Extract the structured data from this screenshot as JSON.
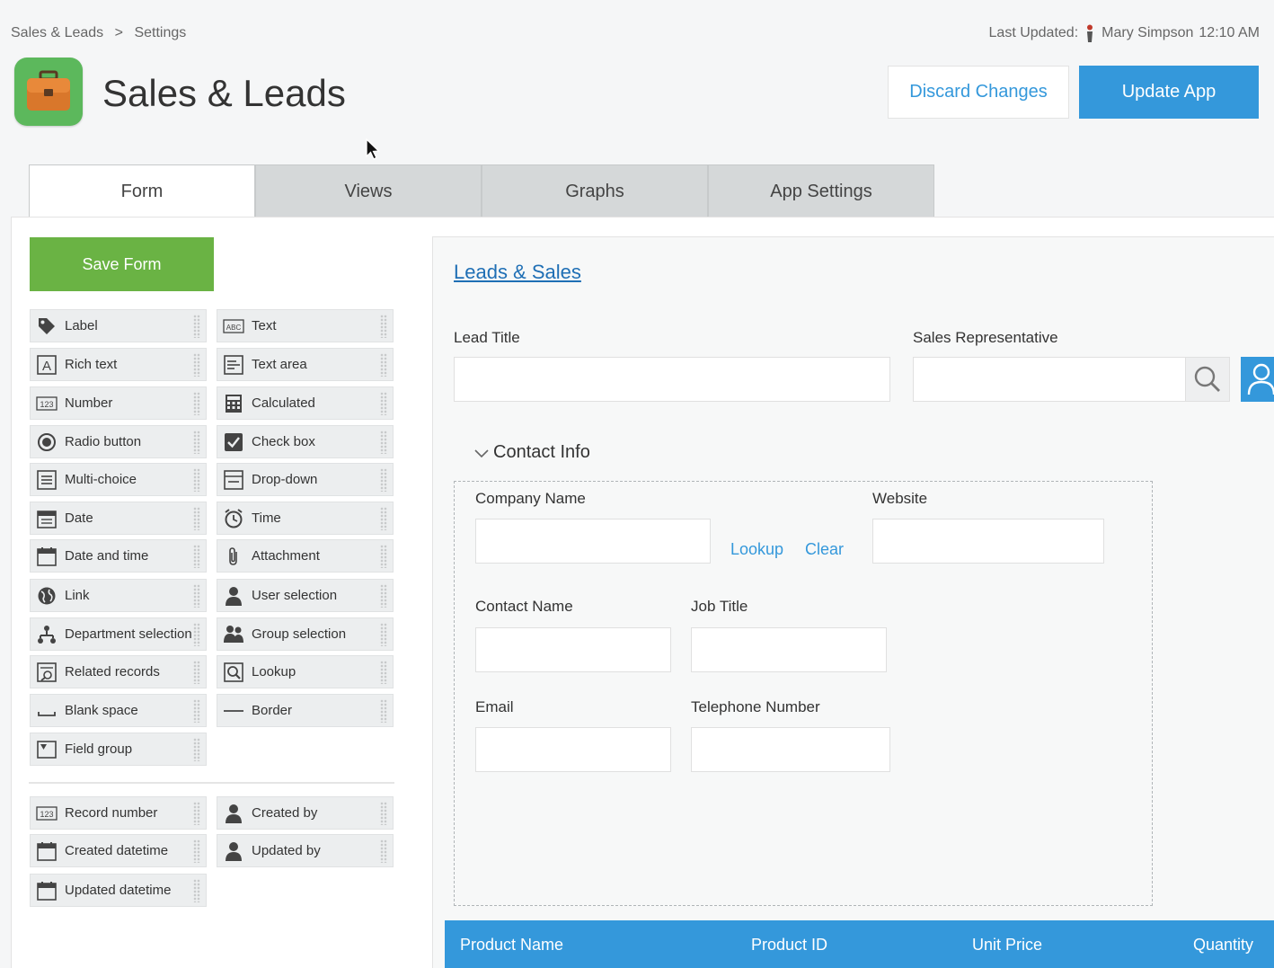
{
  "breadcrumb": {
    "root": "Sales & Leads",
    "separator": ">",
    "current": "Settings"
  },
  "last_updated": {
    "label": "Last Updated:",
    "user": "Mary Simpson",
    "time": "12:10 AM"
  },
  "app": {
    "title": "Sales & Leads",
    "icon": "briefcase-icon",
    "icon_bg": "#5cb85c"
  },
  "header_buttons": {
    "discard": "Discard Changes",
    "update": "Update App"
  },
  "tabs": [
    {
      "label": "Form"
    },
    {
      "label": "Views"
    },
    {
      "label": "Graphs"
    },
    {
      "label": "App Settings"
    }
  ],
  "palette": {
    "save_label": "Save Form",
    "items": [
      {
        "label": "Label",
        "icon": "tag-icon"
      },
      {
        "label": "Text",
        "icon": "text-field-icon"
      },
      {
        "label": "Rich text",
        "icon": "rich-text-icon"
      },
      {
        "label": "Text area",
        "icon": "text-area-icon"
      },
      {
        "label": "Number",
        "icon": "number-icon"
      },
      {
        "label": "Calculated",
        "icon": "calculator-icon"
      },
      {
        "label": "Radio button",
        "icon": "radio-icon"
      },
      {
        "label": "Check box",
        "icon": "checkbox-icon"
      },
      {
        "label": "Multi-choice",
        "icon": "multi-choice-icon"
      },
      {
        "label": "Drop-down",
        "icon": "dropdown-icon"
      },
      {
        "label": "Date",
        "icon": "date-icon"
      },
      {
        "label": "Time",
        "icon": "clock-icon"
      },
      {
        "label": "Date and time",
        "icon": "calendar-icon"
      },
      {
        "label": "Attachment",
        "icon": "paperclip-icon"
      },
      {
        "label": "Link",
        "icon": "globe-icon"
      },
      {
        "label": "User selection",
        "icon": "user-icon"
      },
      {
        "label": "Department selection",
        "icon": "org-chart-icon"
      },
      {
        "label": "Group selection",
        "icon": "group-icon"
      },
      {
        "label": "Related records",
        "icon": "related-records-icon"
      },
      {
        "label": "Lookup",
        "icon": "lookup-icon"
      },
      {
        "label": "Blank space",
        "icon": "blank-space-icon"
      },
      {
        "label": "Border",
        "icon": "border-line-icon"
      },
      {
        "label": "Field group",
        "icon": "field-group-icon"
      }
    ],
    "system_items": [
      {
        "label": "Record number",
        "icon": "number-icon"
      },
      {
        "label": "Created by",
        "icon": "user-icon"
      },
      {
        "label": "Created datetime",
        "icon": "calendar-icon"
      },
      {
        "label": "Updated by",
        "icon": "user-icon"
      },
      {
        "label": "Updated datetime",
        "icon": "calendar-icon"
      }
    ]
  },
  "form": {
    "title": "Leads & Sales",
    "lead_title": "Lead Title",
    "sales_rep": "Sales Representative",
    "group_title": "Contact Info",
    "company_name": "Company Name",
    "lookup": "Lookup",
    "clear": "Clear",
    "website": "Website",
    "contact_name": "Contact Name",
    "job_title": "Job Title",
    "email": "Email",
    "telephone": "Telephone Number"
  },
  "table": {
    "columns": [
      "Product Name",
      "Product ID",
      "Unit Price",
      "Quantity"
    ]
  },
  "colors": {
    "accent": "#3498db",
    "save": "#6ab344"
  }
}
